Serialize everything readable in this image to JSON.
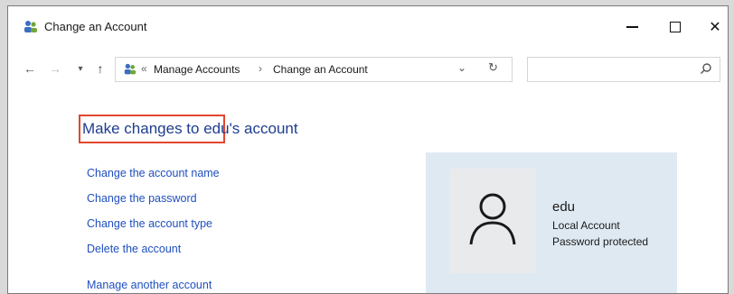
{
  "window": {
    "title": "Change an Account",
    "minimize_icon": "minimize-icon",
    "maximize_icon": "maximize-icon",
    "close_icon": "close-icon"
  },
  "nav": {
    "back_icon": "arrow-left-icon",
    "forward_icon": "arrow-right-icon",
    "recent_icon": "chevron-down-icon",
    "up_icon": "arrow-up-icon"
  },
  "address": {
    "overflow": "«",
    "crumbs": [
      "Manage Accounts",
      "Change an Account"
    ],
    "separator": "›"
  },
  "main": {
    "heading_prefix": "Make changes to edu",
    "heading_suffix": "'s account",
    "links": [
      "Change the account name",
      "Change the password",
      "Change the account type",
      "Delete the account",
      "Manage another account"
    ]
  },
  "user": {
    "name": "edu",
    "account_type": "Local Account",
    "password_status": "Password protected"
  },
  "colors": {
    "link": "#1f4fbf",
    "heading": "#1e3d8f",
    "highlight": "#e2472f",
    "card": "#dfe9f2"
  }
}
